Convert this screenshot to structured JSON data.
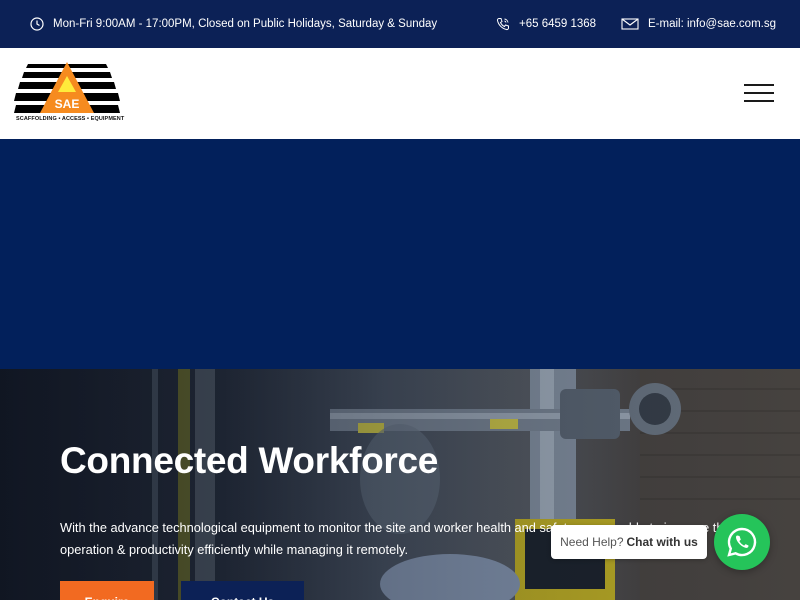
{
  "topbar": {
    "hours": "Mon-Fri 9:00AM - 17:00PM, Closed on Public Holidays, Saturday & Sunday",
    "phone": "+65 6459 1368",
    "email": "E-mail: info@sae.com.sg"
  },
  "header": {
    "logo_text": "SAE",
    "logo_tagline": "SCAFFOLDING • ACCESS • EQUIPMENT"
  },
  "hero": {
    "title": "Connected Workforce",
    "description": "With the advance technological equipment to monitor the site and worker health and safety, we are able to improve the operation & productivity efficiently while managing it remotely.",
    "primary_button": "Enquire",
    "secondary_button": "Contact Us"
  },
  "chat": {
    "prefix": "Need Help?",
    "bold": "Chat with us"
  },
  "colors": {
    "topbar_bg": "#0c2156",
    "navy_band": "#02205b",
    "accent_orange": "#f26a21",
    "whatsapp_green": "#25c45a"
  },
  "icons": [
    "clock-icon",
    "phone-icon",
    "envelope-icon",
    "hamburger-menu-icon",
    "whatsapp-icon"
  ]
}
